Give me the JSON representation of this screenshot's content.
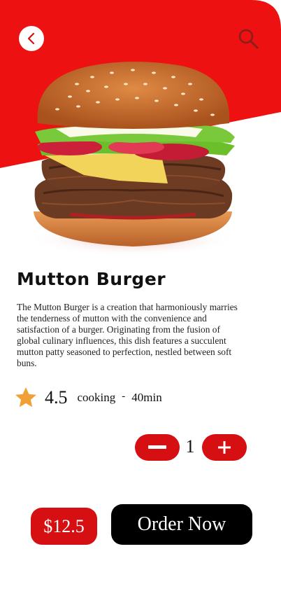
{
  "colors": {
    "accent": "#d50f12",
    "dark": "#000000",
    "star": "#f0a035"
  },
  "header": {
    "back_icon": "chevron-left-icon",
    "search_icon": "search-icon"
  },
  "product": {
    "name": "Mutton Burger",
    "description": "The Mutton Burger is a creation that harmoniously marries the tenderness of mutton with the convenience and satisfaction of a burger. Originating from the fusion of global culinary influences, this dish features a succulent mutton patty seasoned to perfection, nestled between soft buns.",
    "rating": "4.5",
    "cooking_label": "cooking",
    "separator": "-",
    "cooking_time": "40min"
  },
  "quantity": {
    "value": "1",
    "minus_icon": "minus-icon",
    "plus_icon": "plus-icon"
  },
  "footer": {
    "price": "$12.5",
    "order_label": "Order Now"
  }
}
